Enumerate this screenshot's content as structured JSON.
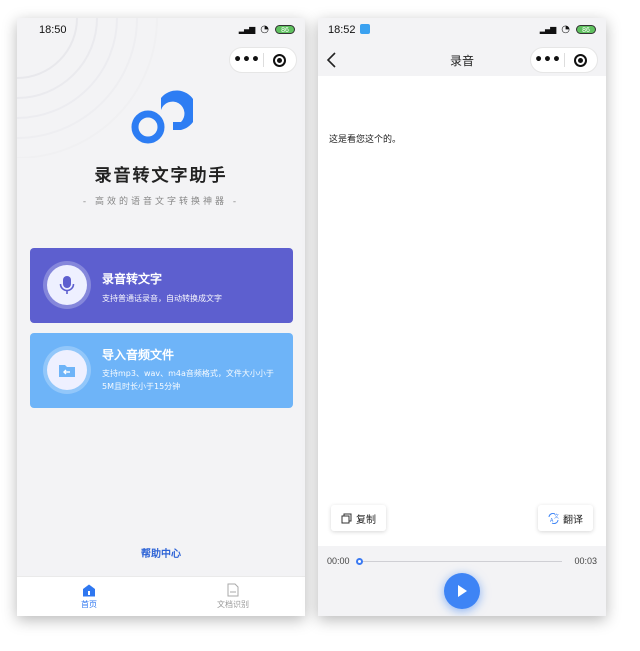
{
  "left_screen": {
    "status": {
      "time": "18:50",
      "battery": "86"
    },
    "app_title": "录音转文字助手",
    "app_subtitle": "- 高效的语音文字转换神器 -",
    "cards": [
      {
        "title": "录音转文字",
        "desc": "支持普通话录音，自动转换成文字",
        "icon": "microphone-icon"
      },
      {
        "title": "导入音频文件",
        "desc": "支持mp3、wav、m4a音频格式，文件大小小于5M且时长小于15分钟",
        "icon": "folder-import-icon"
      }
    ],
    "help_link": "帮助中心",
    "tabs": [
      {
        "label": "首页",
        "icon": "home-icon",
        "active": true
      },
      {
        "label": "文档识别",
        "icon": "document-icon",
        "active": false
      }
    ]
  },
  "right_screen": {
    "status": {
      "time": "18:52",
      "battery": "86"
    },
    "nav_title": "录音",
    "transcript_text": "这是看您这个的。",
    "copy_label": "复制",
    "translate_label": "翻译",
    "player": {
      "current_time": "00:00",
      "total_time": "00:03",
      "progress": 0
    }
  },
  "colors": {
    "primary": "#5d5fcf",
    "secondary": "#6eb4f8",
    "accent": "#3e84f5",
    "link": "#2d63d6"
  }
}
